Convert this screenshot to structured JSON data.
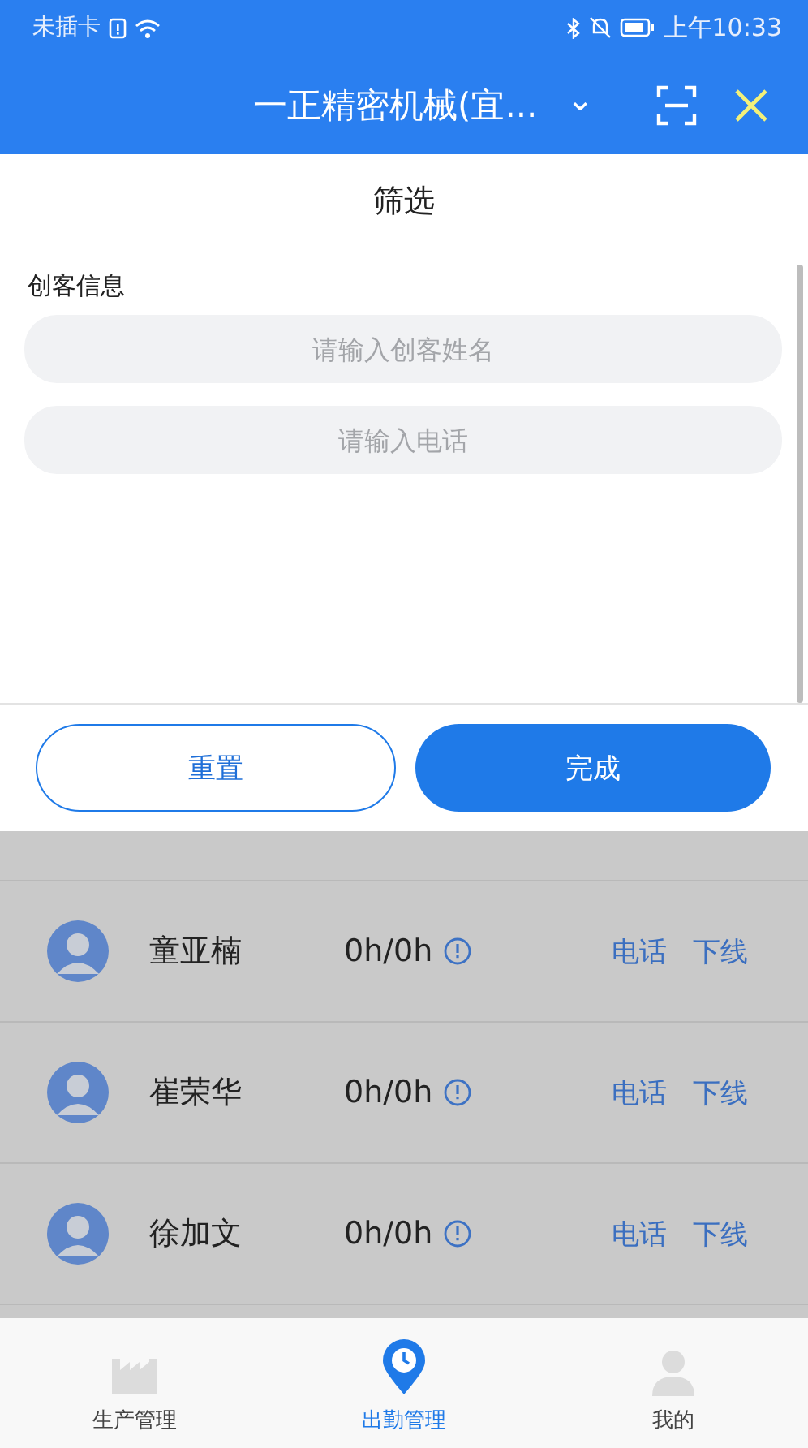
{
  "status_bar": {
    "carrier": "未插卡",
    "time": "上午10:33"
  },
  "nav": {
    "title": "一正精密机械(宜...",
    "dropdown": "⌄"
  },
  "filter": {
    "title": "筛选",
    "section_label": "创客信息",
    "fields": [
      {
        "placeholder": "请输入创客姓名"
      },
      {
        "placeholder": "请输入电话"
      }
    ],
    "buttons": [
      {
        "label": "重置",
        "kind": "outline"
      },
      {
        "label": "完成",
        "kind": "primary"
      }
    ]
  },
  "people": [
    {
      "name": "童亚楠",
      "hours": "0h/0h",
      "actions": [
        "电话",
        "下线"
      ]
    },
    {
      "name": "崔荣华",
      "hours": "0h/0h",
      "actions": [
        "电话",
        "下线"
      ]
    },
    {
      "name": "徐加文",
      "hours": "0h/0h",
      "actions": [
        "电话",
        "下线"
      ]
    }
  ],
  "tabs": [
    {
      "label": "生产管理",
      "kind": "factory",
      "selected": false
    },
    {
      "label": "出勤管理",
      "kind": "clock",
      "selected": true
    },
    {
      "label": "我的",
      "kind": "person",
      "selected": false
    }
  ]
}
